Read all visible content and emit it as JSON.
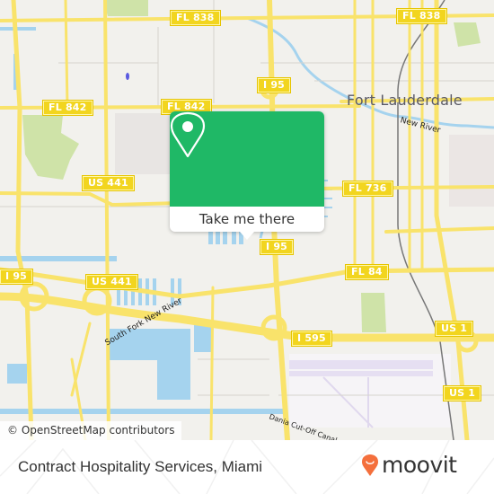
{
  "map": {
    "attribution": "© OpenStreetMap contributors",
    "city_label": "Fort Lauderdale",
    "water_labels": {
      "new_river": "New River",
      "south_fork": "South Fork New River",
      "dania_canal": "Dania Cut-Off Canal"
    },
    "road_shields": {
      "fl838_a": "FL 838",
      "fl838_b": "FL 838",
      "fl842_a": "FL 842",
      "fl842_b": "FL 842",
      "i95_a": "I 95",
      "i95_b": "I 95",
      "i95_c": "I 95",
      "us441_a": "US 441",
      "us441_b": "US 441",
      "fl736": "FL 736",
      "fl84": "FL 84",
      "i595": "I 595",
      "us1_a": "US 1",
      "us1_b": "US 1"
    },
    "colors": {
      "land": "#f2f1ed",
      "water": "#a5d3ee",
      "road": "#f9e36b",
      "park": "#cfe3a8",
      "airport": "#e8e2f2"
    }
  },
  "popup": {
    "icon": "location-pin-icon",
    "button_label": "Take me there",
    "color": "#1fb866"
  },
  "footer": {
    "place_name": "Contract Hospitality Services, Miami",
    "brand_name": "moovit",
    "brand_icon": "moovit-smile-pin-icon",
    "brand_color": "#f46f3c"
  }
}
